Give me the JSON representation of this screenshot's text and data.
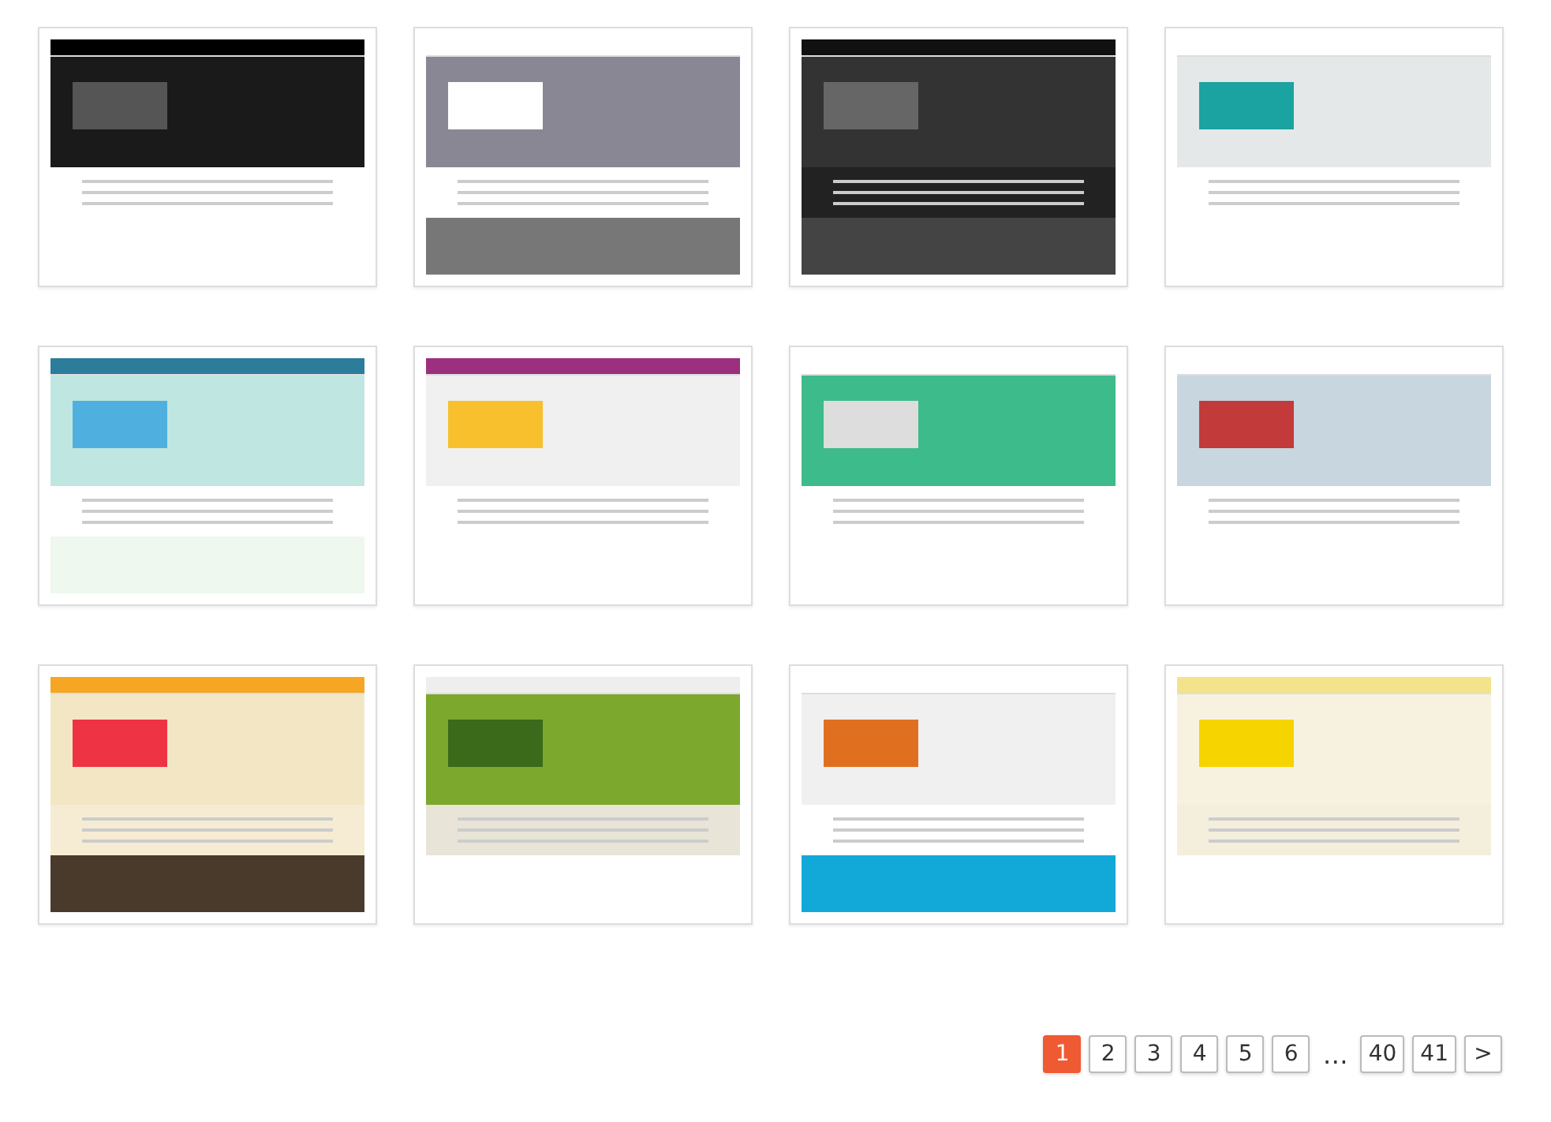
{
  "templates": [
    {
      "kind": "watch-white"
    },
    {
      "kind": "watch-grey"
    },
    {
      "kind": "watch-dark"
    },
    {
      "kind": "rubber-teal"
    },
    {
      "kind": "rubber-mint"
    },
    {
      "kind": "rubber-toys"
    },
    {
      "kind": "rubber-green"
    },
    {
      "kind": "books-sky"
    },
    {
      "kind": "books-orange"
    },
    {
      "kind": "books-olive"
    },
    {
      "kind": "books-blue"
    },
    {
      "kind": "books-yellow"
    }
  ],
  "pagination": {
    "pages": [
      {
        "label": "1",
        "selected": true
      },
      {
        "label": "2",
        "selected": false
      },
      {
        "label": "3",
        "selected": false
      },
      {
        "label": "4",
        "selected": false
      },
      {
        "label": "5",
        "selected": false
      },
      {
        "label": "6",
        "selected": false
      },
      {
        "label": "…",
        "kind": "ellipsis"
      },
      {
        "label": "40",
        "selected": false
      },
      {
        "label": "41",
        "selected": false
      }
    ],
    "next": ">"
  }
}
